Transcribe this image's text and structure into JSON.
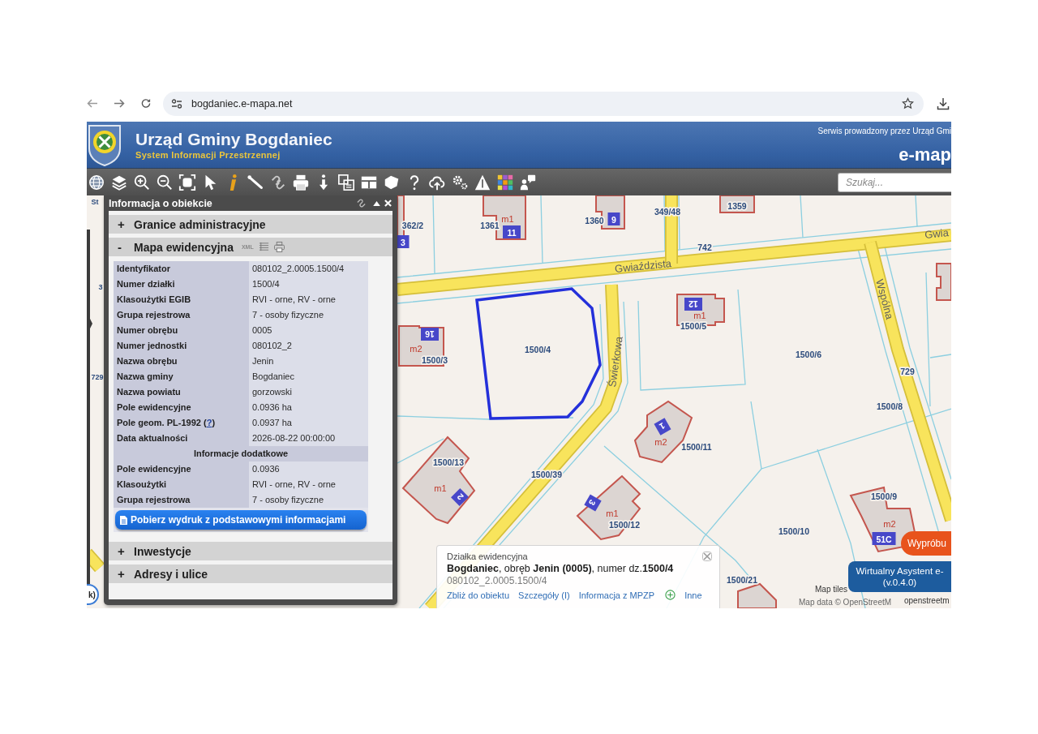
{
  "browser": {
    "url": "bogdaniec.e-mapa.net"
  },
  "header": {
    "title": "Urząd Gminy Bogdaniec",
    "subtitle": "System Informacji Przestrzennej",
    "operator": "Serwis prowadzony przez Urząd Gmi",
    "brand": "e-map"
  },
  "toolbar": {
    "search": {
      "placeholder": "Szukaj..."
    }
  },
  "panel": {
    "title": "Informacja o obiekcie",
    "sections": [
      {
        "sign": "+",
        "title": "Granice administracyjne",
        "expanded": false
      },
      {
        "sign": "-",
        "title": "Mapa ewidencyjna",
        "expanded": true,
        "export_label": "XML",
        "rows": [
          {
            "kind": "field",
            "label": "Identyfikator",
            "value": "080102_2.0005.1500/4"
          },
          {
            "kind": "field",
            "label": "Numer działki",
            "value": "1500/4"
          },
          {
            "kind": "field",
            "label": "Klasoużytki EGIB",
            "value": "RVI - orne, RV - orne"
          },
          {
            "kind": "field",
            "label": "Grupa rejestrowa",
            "value": "7 - osoby fizyczne"
          },
          {
            "kind": "field",
            "label": "Numer obrębu",
            "value": "0005"
          },
          {
            "kind": "field",
            "label": "Numer jednostki",
            "value": "080102_2"
          },
          {
            "kind": "field",
            "label": "Nazwa obrębu",
            "value": "Jenin"
          },
          {
            "kind": "field",
            "label": "Nazwa gminy",
            "value": "Bogdaniec"
          },
          {
            "kind": "field",
            "label": "Nazwa powiatu",
            "value": "gorzowski"
          },
          {
            "kind": "field",
            "label": "Pole ewidencyjne",
            "value": "0.0936 ha"
          },
          {
            "kind": "field",
            "label": "Pole geom. PL-1992 (",
            "help_link": "?",
            "label_end": ")",
            "value": "0.0937 ha"
          },
          {
            "kind": "field",
            "label": "Data aktualności",
            "value": "2026-08-22 00:00:00"
          },
          {
            "kind": "heading",
            "label": "Informacje dodatkowe"
          },
          {
            "kind": "field",
            "label": "Pole ewidencyjne",
            "value": "0.0936"
          },
          {
            "kind": "field",
            "label": "Klasoużytki",
            "value": "RVI - orne, RV - orne"
          },
          {
            "kind": "field",
            "label": "Grupa rejestrowa",
            "value": "7 - osoby fizyczne"
          }
        ],
        "button": "Pobierz wydruk z podstawowymi informacjami"
      },
      {
        "sign": "+",
        "title": "Inwestycje",
        "expanded": false
      },
      {
        "sign": "+",
        "title": "Adresy i ulice",
        "expanded": false
      }
    ]
  },
  "map": {
    "labels": [
      {
        "text": "362/2",
        "kind": "parcel"
      },
      {
        "text": "3",
        "kind": "number"
      },
      {
        "text": "1361",
        "kind": "parcel"
      },
      {
        "text": "m1",
        "kind": "use"
      },
      {
        "text": "11",
        "kind": "number"
      },
      {
        "text": "1360",
        "kind": "parcel"
      },
      {
        "text": "9",
        "kind": "number"
      },
      {
        "text": "349/48",
        "kind": "parcel"
      },
      {
        "text": "1359",
        "kind": "parcel"
      },
      {
        "text": "742",
        "kind": "parcel"
      },
      {
        "text": "Gwiaździsta",
        "kind": "street"
      },
      {
        "text": "Gwia",
        "kind": "street"
      },
      {
        "text": "12",
        "kind": "number"
      },
      {
        "text": "m1",
        "kind": "use"
      },
      {
        "text": "1500/5",
        "kind": "parcel"
      },
      {
        "text": "16",
        "kind": "number"
      },
      {
        "text": "m2",
        "kind": "use"
      },
      {
        "text": "1500/3",
        "kind": "parcel"
      },
      {
        "text": "1500/4",
        "kind": "parcel"
      },
      {
        "text": "Świerkowa",
        "kind": "street"
      },
      {
        "text": "1500/6",
        "kind": "parcel"
      },
      {
        "text": "Wspólna",
        "kind": "street"
      },
      {
        "text": "729",
        "kind": "parcel"
      },
      {
        "text": "1500/8",
        "kind": "parcel"
      },
      {
        "text": "1",
        "kind": "number"
      },
      {
        "text": "m2",
        "kind": "use"
      },
      {
        "text": "1500/11",
        "kind": "parcel"
      },
      {
        "text": "1500/13",
        "kind": "parcel"
      },
      {
        "text": "m1",
        "kind": "use"
      },
      {
        "text": "2",
        "kind": "number"
      },
      {
        "text": "1500/39",
        "kind": "parcel"
      },
      {
        "text": "3",
        "kind": "number"
      },
      {
        "text": "m1",
        "kind": "use"
      },
      {
        "text": "1500/12",
        "kind": "parcel"
      },
      {
        "text": "1500/9",
        "kind": "parcel"
      },
      {
        "text": "m2",
        "kind": "use"
      },
      {
        "text": "51C",
        "kind": "number"
      },
      {
        "text": "1500/10",
        "kind": "parcel"
      },
      {
        "text": "1500/21",
        "kind": "parcel"
      },
      {
        "text": "St",
        "kind": "edge"
      },
      {
        "text": "3",
        "kind": "edge"
      },
      {
        "text": "729",
        "kind": "edge"
      }
    ],
    "side_button": "k)"
  },
  "popup": {
    "type_label": "Działka ewidencyjna",
    "summary": "**Bogdaniec**, obręb **Jenin (0005)**, numer dz.**1500/4**",
    "identifier": "080102_2.0005.1500/4",
    "links": [
      {
        "kind": "link",
        "label": "Zbliż do obiektu"
      },
      {
        "kind": "link",
        "label": "Szczegóły (I)"
      },
      {
        "kind": "link",
        "label": "Informacja z MPZP"
      },
      {
        "kind": "more",
        "label": "Inne"
      }
    ]
  },
  "assistant": {
    "try_label": "Wypróbu",
    "title": "Wirtualny Asystent e-",
    "version": "(v.0.4.0)"
  },
  "attribution": {
    "tiles": "Map tiles",
    "data": "Map data © OpenStreetM",
    "link": "openstreetm"
  }
}
